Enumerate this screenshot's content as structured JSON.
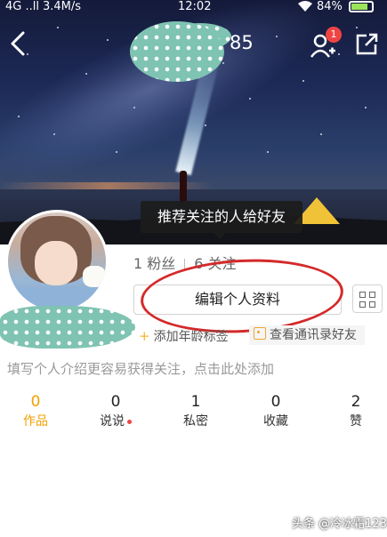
{
  "status_bar": {
    "signal": "4G ..ll",
    "speed": "3.4M/s",
    "time": "12:02",
    "wifi_icon": "wifi-icon",
    "battery_percent": "84%",
    "battery_level": 0.84
  },
  "header": {
    "count_suffix": "85",
    "notification_badge": "1",
    "back_icon": "back-arrow-icon",
    "add_friend_icon": "add-friend-icon",
    "share_icon": "share-icon"
  },
  "tooltip": "推荐关注的人给好友",
  "profile": {
    "fans": "1 粉丝",
    "following": "6 关注",
    "edit_button": "编辑个人资料",
    "add_tag": "添加年龄标签",
    "view_contacts": "查看通讯录好友",
    "intro_placeholder": "填写个人介绍更容易获得关注，点击此处添加"
  },
  "tabs": [
    {
      "count": "0",
      "label": "作品"
    },
    {
      "count": "0",
      "label": "说说"
    },
    {
      "count": "1",
      "label": "私密"
    },
    {
      "count": "0",
      "label": "收藏"
    },
    {
      "count": "2",
      "label": "赞"
    }
  ],
  "watermark": "头条 @冷冰霜123",
  "colors": {
    "accent": "#f0a000",
    "annotation_circle": "#d42a2a",
    "badge": "#f04444"
  }
}
